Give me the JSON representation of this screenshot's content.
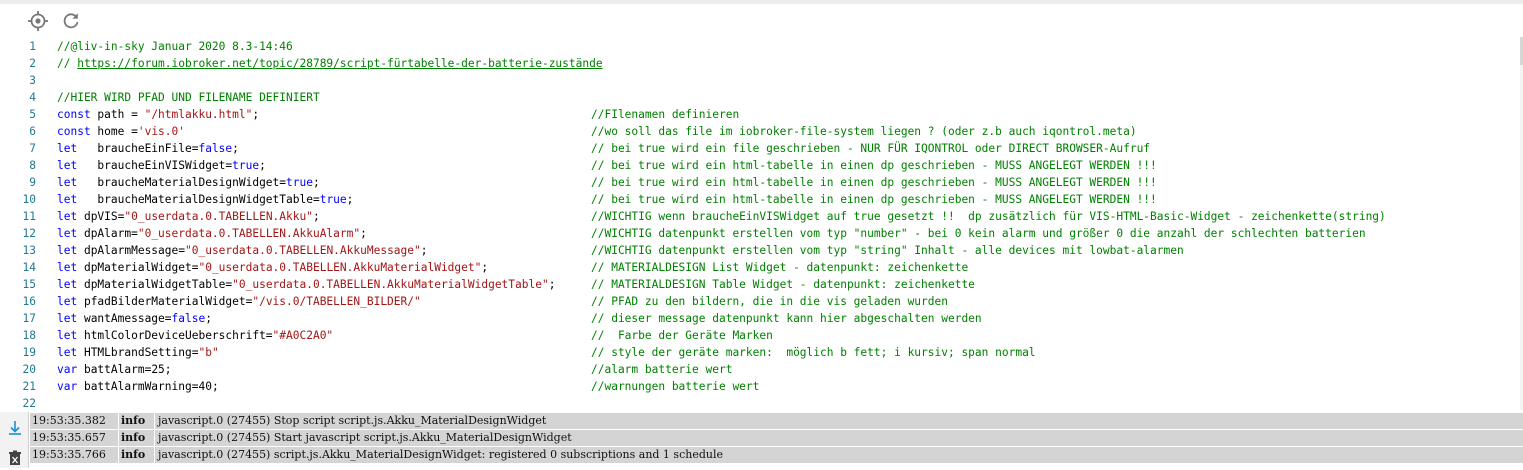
{
  "toolbar": {
    "icons": [
      "crosshair-icon",
      "refresh-icon"
    ]
  },
  "editor": {
    "lines": [
      {
        "n": "1",
        "code": [
          {
            "t": "//@liv-in-sky Januar 2020 8.3-14:46",
            "c": "cm"
          }
        ],
        "comment": ""
      },
      {
        "n": "2",
        "code": [
          {
            "t": "// ",
            "c": "cm"
          },
          {
            "t": "https://forum.iobroker.net/topic/28789/script-fürtabelle-der-batterie-zustände",
            "c": "link"
          }
        ],
        "comment": ""
      },
      {
        "n": "3",
        "code": [],
        "comment": ""
      },
      {
        "n": "4",
        "code": [
          {
            "t": "//HIER WIRD PFAD UND FILENAME DEFINIERT",
            "c": "cm"
          }
        ],
        "comment": ""
      },
      {
        "n": "5",
        "code": [
          {
            "t": "const",
            "c": "kw"
          },
          {
            "t": " path = ",
            "c": ""
          },
          {
            "t": "\"/htmlakku.html\"",
            "c": "str"
          },
          {
            "t": ";",
            "c": ""
          }
        ],
        "comment": "//FIlenamen definieren"
      },
      {
        "n": "6",
        "code": [
          {
            "t": "const",
            "c": "kw"
          },
          {
            "t": " home =",
            "c": ""
          },
          {
            "t": "'vis.0'",
            "c": "str"
          }
        ],
        "comment": "//wo soll das file im iobroker-file-system liegen ? (oder z.b auch iqontrol.meta)"
      },
      {
        "n": "7",
        "code": [
          {
            "t": "let",
            "c": "kw"
          },
          {
            "t": "   braucheEinFile=",
            "c": ""
          },
          {
            "t": "false",
            "c": "kw"
          },
          {
            "t": ";",
            "c": ""
          }
        ],
        "comment": "// bei true wird ein file geschrieben - NUR FÜR IQONTROL oder DIRECT BROWSER-Aufruf"
      },
      {
        "n": "8",
        "code": [
          {
            "t": "let",
            "c": "kw"
          },
          {
            "t": "   braucheEinVISWidget=",
            "c": ""
          },
          {
            "t": "true",
            "c": "kw"
          },
          {
            "t": ";",
            "c": ""
          }
        ],
        "comment": "// bei true wird ein html-tabelle in einen dp geschrieben - MUSS ANGELEGT WERDEN !!!"
      },
      {
        "n": "9",
        "code": [
          {
            "t": "let",
            "c": "kw"
          },
          {
            "t": "   braucheMaterialDesignWidget=",
            "c": ""
          },
          {
            "t": "true",
            "c": "kw"
          },
          {
            "t": ";",
            "c": ""
          }
        ],
        "comment": "// bei true wird ein html-tabelle in einen dp geschrieben - MUSS ANGELEGT WERDEN !!!"
      },
      {
        "n": "10",
        "code": [
          {
            "t": "let",
            "c": "kw"
          },
          {
            "t": "   braucheMaterialDesignWidgetTable=",
            "c": ""
          },
          {
            "t": "true",
            "c": "kw"
          },
          {
            "t": ";",
            "c": ""
          }
        ],
        "comment": "// bei true wird ein html-tabelle in einen dp geschrieben - MUSS ANGELEGT WERDEN !!!"
      },
      {
        "n": "11",
        "code": [
          {
            "t": "let",
            "c": "kw"
          },
          {
            "t": " dpVIS=",
            "c": ""
          },
          {
            "t": "\"0_userdata.0.TABELLEN.Akku\"",
            "c": "str"
          },
          {
            "t": ";",
            "c": ""
          }
        ],
        "comment": "//WICHTIG wenn braucheEinVISWidget auf true gesetzt !!  dp zusätzlich für VIS-HTML-Basic-Widget - zeichenkette(string)"
      },
      {
        "n": "12",
        "code": [
          {
            "t": "let",
            "c": "kw"
          },
          {
            "t": " dpAlarm=",
            "c": ""
          },
          {
            "t": "\"0_userdata.0.TABELLEN.AkkuAlarm\"",
            "c": "str"
          },
          {
            "t": ";",
            "c": ""
          }
        ],
        "comment": "//WICHTIG datenpunkt erstellen vom typ \"number\" - bei 0 kein alarm und größer 0 die anzahl der schlechten batterien"
      },
      {
        "n": "13",
        "code": [
          {
            "t": "let",
            "c": "kw"
          },
          {
            "t": " dpAlarmMessage=",
            "c": ""
          },
          {
            "t": "\"0_userdata.0.TABELLEN.AkkuMessage\"",
            "c": "str"
          },
          {
            "t": ";",
            "c": ""
          }
        ],
        "comment": "//WICHTIG datenpunkt erstellen vom typ \"string\" Inhalt - alle devices mit lowbat-alarmen"
      },
      {
        "n": "14",
        "code": [
          {
            "t": "let",
            "c": "kw"
          },
          {
            "t": " dpMaterialWidget=",
            "c": ""
          },
          {
            "t": "\"0_userdata.0.TABELLEN.AkkuMaterialWidget\"",
            "c": "str"
          },
          {
            "t": ";",
            "c": ""
          }
        ],
        "comment": "// MATERIALDESIGN List Widget - datenpunkt: zeichenkette"
      },
      {
        "n": "15",
        "code": [
          {
            "t": "let",
            "c": "kw"
          },
          {
            "t": " dpMaterialWidgetTable=",
            "c": ""
          },
          {
            "t": "\"0_userdata.0.TABELLEN.AkkuMaterialWidgetTable\"",
            "c": "str"
          },
          {
            "t": ";",
            "c": ""
          }
        ],
        "comment": "// MATERIALDESIGN Table Widget - datenpunkt: zeichenkette"
      },
      {
        "n": "16",
        "code": [
          {
            "t": "let",
            "c": "kw"
          },
          {
            "t": " pfadBilderMaterialWidget=",
            "c": ""
          },
          {
            "t": "\"/vis.0/TABELLEN_BILDER/\"",
            "c": "str"
          }
        ],
        "comment": "// PFAD zu den bildern, die in die vis geladen wurden"
      },
      {
        "n": "17",
        "code": [
          {
            "t": "let",
            "c": "kw"
          },
          {
            "t": " wantAmessage=",
            "c": ""
          },
          {
            "t": "false",
            "c": "kw"
          },
          {
            "t": ";",
            "c": ""
          }
        ],
        "comment": "// dieser message datenpunkt kann hier abgeschalten werden"
      },
      {
        "n": "18",
        "code": [
          {
            "t": "let",
            "c": "kw"
          },
          {
            "t": " htmlColorDeviceUeberschrift=",
            "c": ""
          },
          {
            "t": "\"#A0C2A0\"",
            "c": "str"
          }
        ],
        "comment": "//  Farbe der Geräte Marken"
      },
      {
        "n": "19",
        "code": [
          {
            "t": "let",
            "c": "kw"
          },
          {
            "t": " HTMLbrandSetting=",
            "c": ""
          },
          {
            "t": "\"b\"",
            "c": "str"
          }
        ],
        "comment": "// style der geräte marken:  möglich b fett; i kursiv; span normal"
      },
      {
        "n": "20",
        "code": [
          {
            "t": "var",
            "c": "kw"
          },
          {
            "t": " battAlarm=",
            "c": ""
          },
          {
            "t": "25",
            "c": ""
          },
          {
            "t": ";",
            "c": ""
          }
        ],
        "comment": "//alarm batterie wert"
      },
      {
        "n": "21",
        "code": [
          {
            "t": "var",
            "c": "kw"
          },
          {
            "t": " battAlarmWarning=",
            "c": ""
          },
          {
            "t": "40",
            "c": ""
          },
          {
            "t": ";",
            "c": ""
          }
        ],
        "comment": "//warnungen batterie wert"
      },
      {
        "n": "22",
        "code": [],
        "comment": ""
      }
    ]
  },
  "log": {
    "sidebar_icons": [
      "scroll-down-icon",
      "clear-log-icon"
    ],
    "entries": [
      {
        "time": "19:53:35.382",
        "severity": "info",
        "message": "javascript.0 (27455) Stop script script.js.Akku_MaterialDesignWidget"
      },
      {
        "time": "19:53:35.657",
        "severity": "info",
        "message": "javascript.0 (27455) Start javascript script.js.Akku_MaterialDesignWidget"
      },
      {
        "time": "19:53:35.766",
        "severity": "info",
        "message": "javascript.0 (27455) script.js.Akku_MaterialDesignWidget: registered 0 subscriptions and 1 schedule"
      }
    ]
  }
}
